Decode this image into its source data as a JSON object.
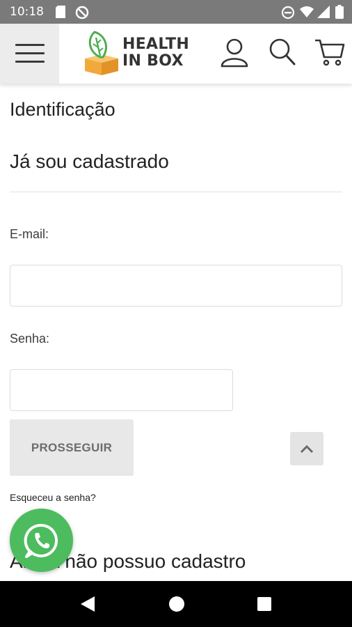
{
  "status_bar": {
    "time": "10:18",
    "left_icons": [
      "sd-card-icon",
      "no-disturb-icon"
    ],
    "right_icons": [
      "do-not-disturb-icon",
      "wifi-icon",
      "signal-icon",
      "battery-icon"
    ]
  },
  "header": {
    "brand_line1": "HEALTH",
    "brand_line2": "IN BOX",
    "icons": [
      "menu-icon",
      "user-icon",
      "search-icon",
      "cart-icon"
    ],
    "logo_colors": {
      "box": "#f2a93b",
      "leaf": "#4caf50"
    }
  },
  "page": {
    "title": "Identificação",
    "login_section_title": "Já sou cadastrado",
    "email_label": "E-mail:",
    "email_value": "",
    "password_label": "Senha:",
    "password_value": "",
    "submit_label": "PROSSEGUIR",
    "forgot_link": "Esqueceu a senha?",
    "new_customer_title": "Ainda não possuo cadastro"
  },
  "floating": {
    "whatsapp_color": "#4cbc5e",
    "back_to_top_icon": "chevron-up-icon"
  },
  "nav_bar": {
    "icons": [
      "back-icon",
      "home-icon",
      "recents-icon"
    ]
  }
}
